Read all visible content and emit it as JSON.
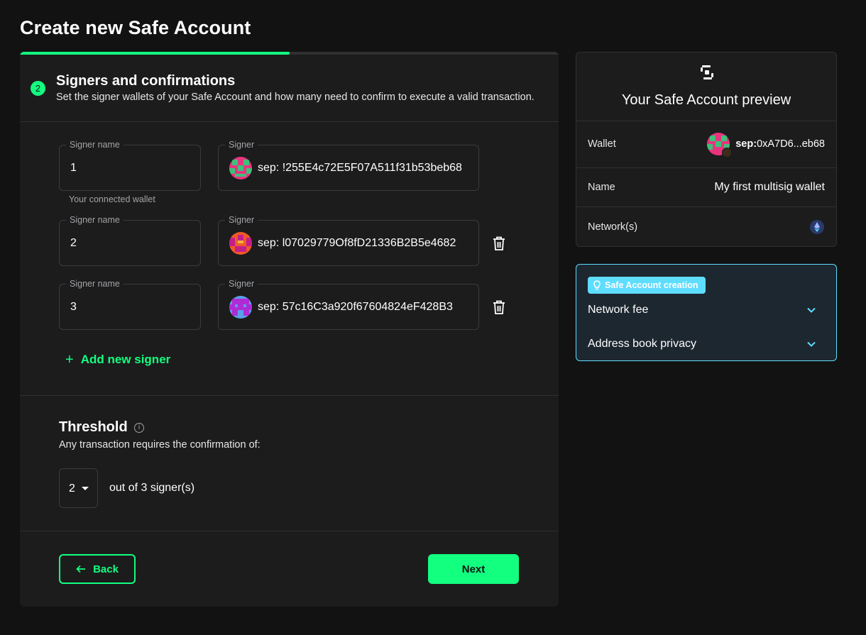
{
  "page": {
    "title": "Create new Safe Account"
  },
  "progress": {
    "fraction": 0.5
  },
  "step": {
    "number": "2",
    "title": "Signers and confirmations",
    "description": "Set the signer wallets of your Safe Account and how many need to confirm to execute a valid transaction."
  },
  "signers": [
    {
      "name_label": "Signer name",
      "name": "1",
      "helper": "Your connected wallet",
      "addr_label": "Signer",
      "address": "sep: !255E4c72E5F07A511f31b53beb68",
      "removable": false
    },
    {
      "name_label": "Signer name",
      "name": "2",
      "addr_label": "Signer",
      "address": "sep: l07029779Of8fD21336B2B5e4682",
      "removable": true
    },
    {
      "name_label": "Signer name",
      "name": "3",
      "addr_label": "Signer",
      "address": "sep: 57c16C3a920f67604824eF428B3",
      "removable": true
    }
  ],
  "add_signer": {
    "label": "Add new signer",
    "icon": "plus-icon"
  },
  "threshold": {
    "title": "Threshold",
    "description": "Any transaction requires the confirmation of:",
    "value": "2",
    "suffix": "out of 3 signer(s)"
  },
  "buttons": {
    "back": "Back",
    "next": "Next"
  },
  "preview": {
    "title": "Your Safe Account preview",
    "wallet_label": "Wallet",
    "wallet_prefix": "sep:",
    "wallet_address": "0xA7D6...eb68",
    "name_label": "Name",
    "name_value": "My first multisig wallet",
    "networks_label": "Network(s)",
    "network_icon": "sepolia-network-icon"
  },
  "creation": {
    "badge": "Safe Account creation",
    "items": [
      {
        "label": "Network fee"
      },
      {
        "label": "Address book privacy"
      }
    ]
  },
  "colors": {
    "background": "#121212",
    "card": "#1c1c1c",
    "accent": "#12ff80",
    "info": "#5fddff"
  }
}
